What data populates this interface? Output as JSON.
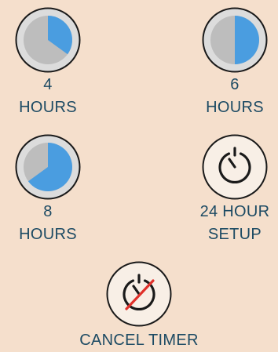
{
  "options": [
    {
      "id": "4h",
      "line1": "4",
      "line2": "HOURS",
      "fraction": 0.35
    },
    {
      "id": "6h",
      "line1": "6",
      "line2": "HOURS",
      "fraction": 0.5
    },
    {
      "id": "8h",
      "line1": "8",
      "line2": "HOURS",
      "fraction": 0.65
    },
    {
      "id": "24h",
      "line1": "24 HOUR",
      "line2": "SETUP",
      "icon": "timer-icon"
    }
  ],
  "cancel": {
    "label": "CANCEL TIMER",
    "icon": "timer-cancel-icon"
  },
  "colors": {
    "background": "#f5dfcc",
    "ink": "#1c4a63",
    "ring": "#1a1a1a",
    "pie_bg": "#bdbdbd",
    "pie_fill": "#4a9de0",
    "slash": "#e0302a"
  }
}
